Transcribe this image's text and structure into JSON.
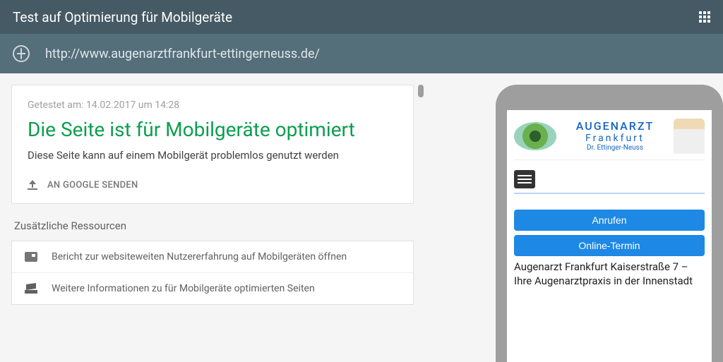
{
  "header": {
    "title": "Test auf Optimierung für Mobilgeräte"
  },
  "urlbar": {
    "url": "http://www.augenarztfrankfurt-ettingerneuss.de/"
  },
  "result": {
    "tested_at": "Getestet am: 14.02.2017 um 14:28",
    "headline": "Die Seite ist für Mobilgeräte optimiert",
    "subline": "Diese Seite kann auf einem Mobilgerät problemlos genutzt werden",
    "send_label": "AN GOOGLE SENDEN"
  },
  "resources": {
    "title": "Zusätzliche Ressourcen",
    "items": [
      "Bericht zur websiteweiten Nutzererfahrung auf Mobilgeräten öffnen",
      "Weitere Informationen zu für Mobilgeräte optimierten Seiten"
    ]
  },
  "preview": {
    "brand_line1": "AUGENARZT",
    "brand_line2": "Frankfurt",
    "brand_line3": "Dr. Ettinger-Neuss",
    "btn_call": "Anrufen",
    "btn_online": "Online-Termin",
    "page_title": "Augenarzt Frankfurt Kaiserstraße 7 – Ihre Augenarztpraxis in der Innenstadt"
  }
}
